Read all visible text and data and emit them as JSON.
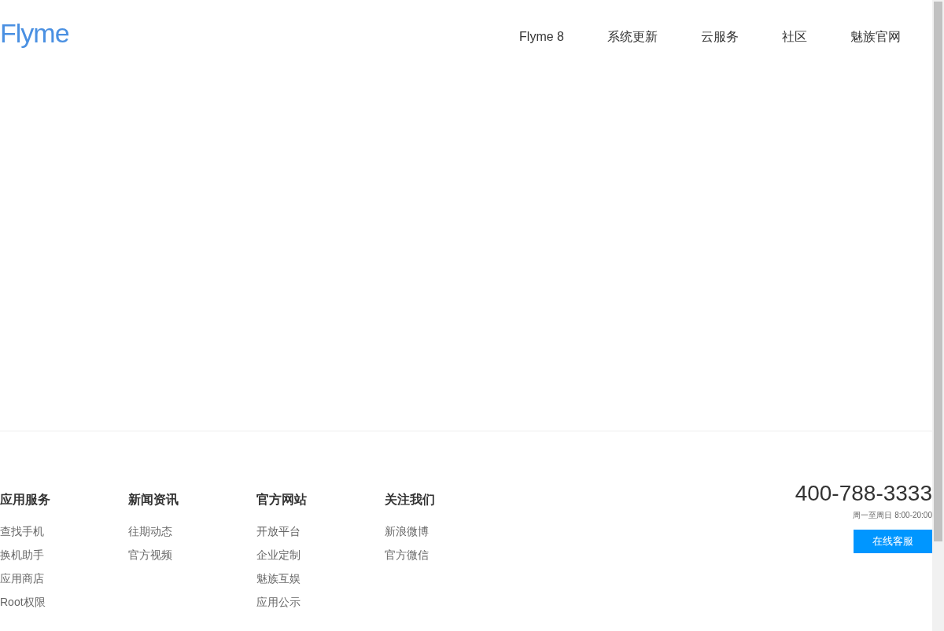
{
  "logo": "Flyme",
  "nav": [
    {
      "label": "Flyme 8"
    },
    {
      "label": "系统更新"
    },
    {
      "label": "云服务"
    },
    {
      "label": "社区"
    },
    {
      "label": "魅族官网"
    }
  ],
  "footer": {
    "columns": [
      {
        "title": "应用服务",
        "links": [
          "查找手机",
          "换机助手",
          "应用商店",
          "Root权限"
        ]
      },
      {
        "title": "新闻资讯",
        "links": [
          "往期动态",
          "官方视频"
        ]
      },
      {
        "title": "官方网站",
        "links": [
          "开放平台",
          "企业定制",
          "魅族互娱",
          "应用公示"
        ]
      },
      {
        "title": "关注我们",
        "links": [
          "新浪微博",
          "官方微信"
        ]
      }
    ],
    "phone": "400-788-3333",
    "hours": "周一至周日 8:00-20:00",
    "service_button": "在线客服"
  }
}
